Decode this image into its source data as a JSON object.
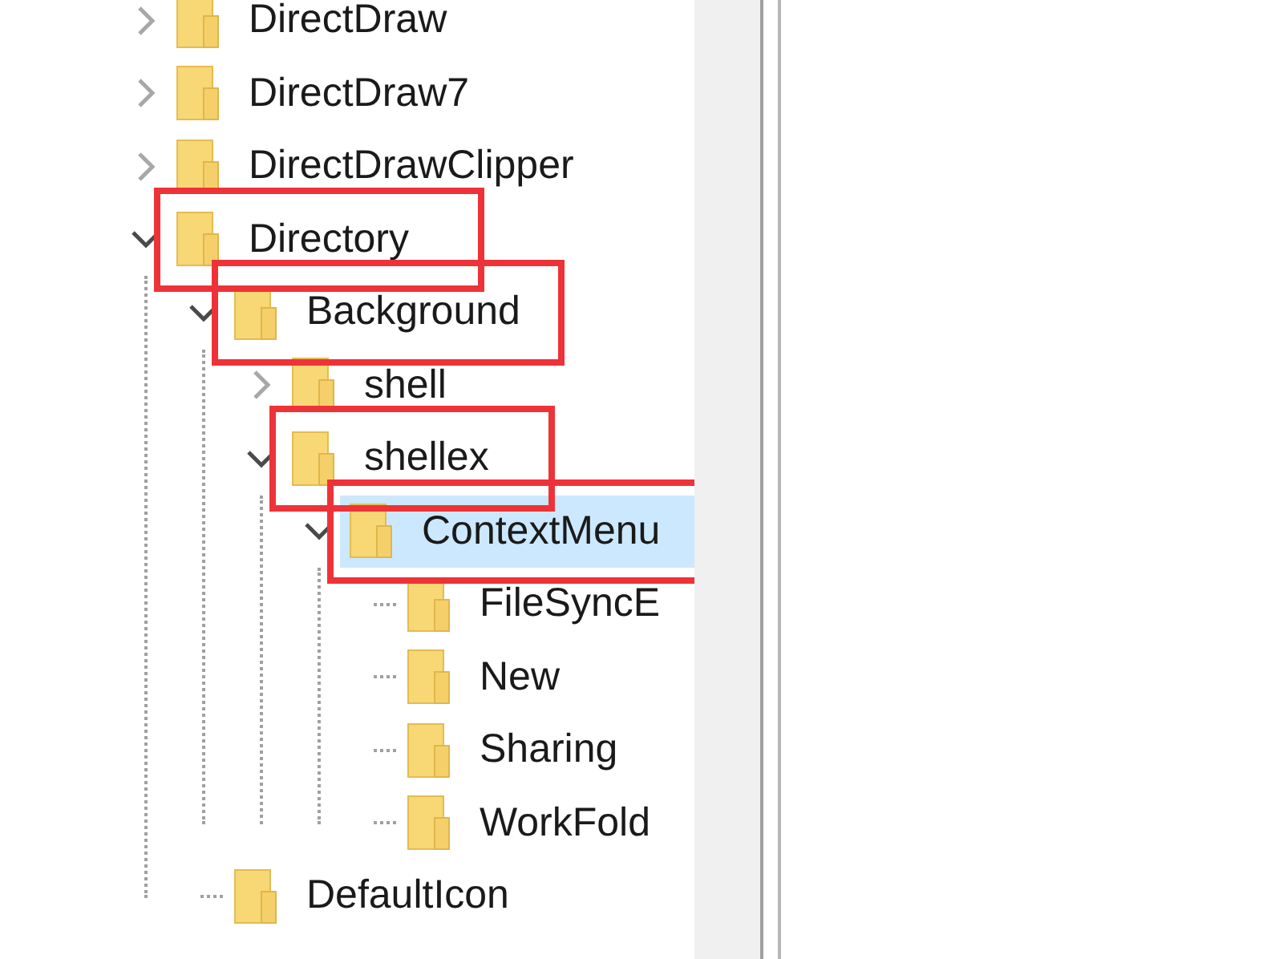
{
  "tree": [
    {
      "label": "DirectDraw",
      "expanded": false,
      "selected": false,
      "highlighted": false
    },
    {
      "label": "DirectDraw7",
      "expanded": false,
      "selected": false,
      "highlighted": false
    },
    {
      "label": "DirectDrawClipper",
      "expanded": false,
      "selected": false,
      "highlighted": false
    },
    {
      "label": "Directory",
      "expanded": true,
      "selected": false,
      "highlighted": true,
      "children": [
        {
          "label": "Background",
          "expanded": true,
          "selected": false,
          "highlighted": true,
          "children": [
            {
              "label": "shell",
              "expanded": false,
              "selected": false,
              "highlighted": false
            },
            {
              "label": "shellex",
              "expanded": true,
              "selected": false,
              "highlighted": true,
              "children": [
                {
                  "label": "ContextMenu",
                  "expanded": true,
                  "selected": true,
                  "highlighted": true,
                  "children": [
                    {
                      "label": "FileSyncE",
                      "selected": false,
                      "highlighted": false
                    },
                    {
                      "label": "New",
                      "selected": false,
                      "highlighted": false
                    },
                    {
                      "label": "Sharing",
                      "selected": false,
                      "highlighted": false
                    },
                    {
                      "label": "WorkFold",
                      "selected": false,
                      "highlighted": false
                    }
                  ]
                }
              ]
            }
          ]
        },
        {
          "label": "DefaultIcon",
          "selected": false,
          "highlighted": false
        }
      ]
    }
  ]
}
